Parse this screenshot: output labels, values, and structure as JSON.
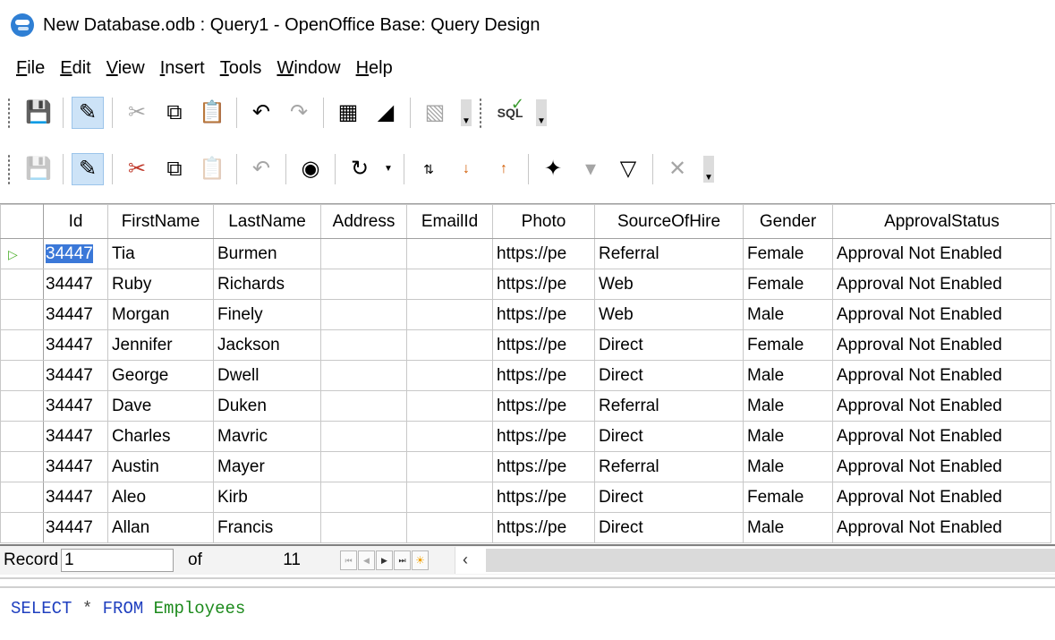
{
  "window": {
    "title": "New Database.odb : Query1 - OpenOffice Base: Query Design"
  },
  "menu": [
    {
      "u": "F",
      "rest": "ile"
    },
    {
      "u": "E",
      "rest": "dit"
    },
    {
      "u": "V",
      "rest": "iew"
    },
    {
      "u": "I",
      "rest": "nsert"
    },
    {
      "u": "T",
      "rest": "ools"
    },
    {
      "u": "W",
      "rest": "indow"
    },
    {
      "u": "H",
      "rest": "elp"
    }
  ],
  "toolbar": {
    "sql_label": "SQL",
    "icons1": [
      "save-icon",
      "edit-mode-icon",
      "cut-icon",
      "copy-icon",
      "paste-icon",
      "undo-icon",
      "redo-icon",
      "add-tables-icon",
      "function-icon",
      "clear-query-icon",
      "run-sql-directly-icon"
    ],
    "icons2": [
      "save-record-icon",
      "edit-data-icon",
      "cut-icon",
      "copy-icon",
      "paste-icon",
      "undo-record-icon",
      "find-record-icon",
      "refresh-icon",
      "sort-icon",
      "sort-ascending-icon",
      "sort-descending-icon",
      "autofilter-icon",
      "standard-filter-icon",
      "apply-filter-icon",
      "remove-filter-icon"
    ]
  },
  "grid": {
    "columns": [
      "Id",
      "FirstName",
      "LastName",
      "Address",
      "EmailId",
      "Photo",
      "SourceOfHire",
      "Gender",
      "ApprovalStatus"
    ],
    "rows": [
      [
        "34447",
        "Tia",
        "Burmen",
        "",
        "",
        "https://pe",
        "Referral",
        "Female",
        "Approval Not Enabled"
      ],
      [
        "34447",
        "Ruby",
        "Richards",
        "",
        "",
        "https://pe",
        "Web",
        "Female",
        "Approval Not Enabled"
      ],
      [
        "34447",
        "Morgan",
        "Finely",
        "",
        "",
        "https://pe",
        "Web",
        "Male",
        "Approval Not Enabled"
      ],
      [
        "34447",
        "Jennifer",
        "Jackson",
        "",
        "",
        "https://pe",
        "Direct",
        "Female",
        "Approval Not Enabled"
      ],
      [
        "34447",
        "George",
        "Dwell",
        "",
        "",
        "https://pe",
        "Direct",
        "Male",
        "Approval Not Enabled"
      ],
      [
        "34447",
        "Dave",
        "Duken",
        "",
        "",
        "https://pe",
        "Referral",
        "Male",
        "Approval Not Enabled"
      ],
      [
        "34447",
        "Charles",
        "Mavric",
        "",
        "",
        "https://pe",
        "Direct",
        "Male",
        "Approval Not Enabled"
      ],
      [
        "34447",
        "Austin",
        "Mayer",
        "",
        "",
        "https://pe",
        "Referral",
        "Male",
        "Approval Not Enabled"
      ],
      [
        "34447",
        "Aleo",
        "Kirb",
        "",
        "",
        "https://pe",
        "Direct",
        "Female",
        "Approval Not Enabled"
      ],
      [
        "34447",
        "Allan",
        "Francis",
        "",
        "",
        "https://pe",
        "Direct",
        "Male",
        "Approval Not Enabled"
      ]
    ]
  },
  "navigation": {
    "record_label": "Record",
    "current": "1",
    "of_label": "of",
    "total": "11"
  },
  "sql": {
    "kw1": "SELECT",
    "star": "*",
    "kw2": "FROM",
    "table": "Employees"
  }
}
